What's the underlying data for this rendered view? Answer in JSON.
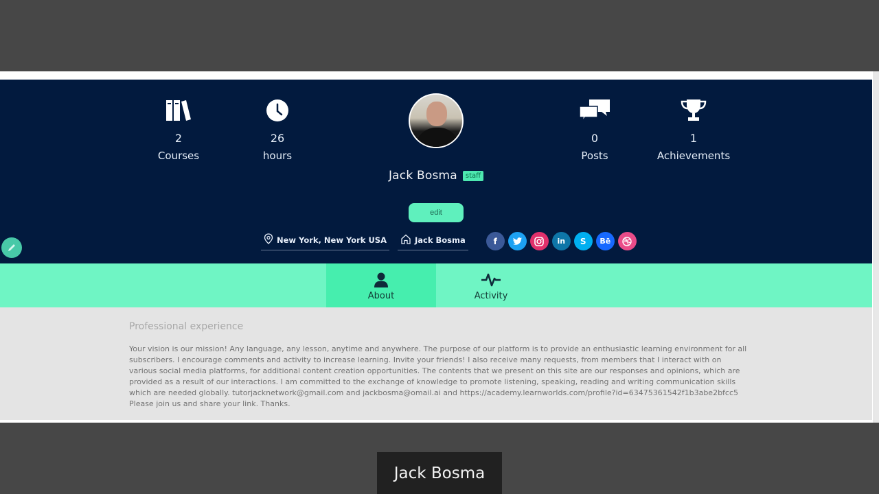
{
  "profile": {
    "name": "Jack Bosma",
    "badge": "staff",
    "edit_label": "edit",
    "location": "New York, New York USA",
    "website_label": "Jack Bosma"
  },
  "stats": [
    {
      "icon": "books-icon",
      "value": "2",
      "label": "Courses"
    },
    {
      "icon": "clock-icon",
      "value": "26",
      "label": "hours"
    },
    {
      "icon": "chat-bubbles-icon",
      "value": "0",
      "label": "Posts"
    },
    {
      "icon": "trophy-icon",
      "value": "1",
      "label": "Achievements"
    }
  ],
  "socials": [
    {
      "name": "facebook",
      "glyph": "f",
      "color": "#3b5998"
    },
    {
      "name": "twitter",
      "glyph": "t",
      "color": "#1da1f2"
    },
    {
      "name": "instagram",
      "glyph": "ig",
      "color": "#e1306c"
    },
    {
      "name": "linkedin",
      "glyph": "in",
      "color": "#0e76a8"
    },
    {
      "name": "skype",
      "glyph": "S",
      "color": "#00aff0"
    },
    {
      "name": "behance",
      "glyph": "Bē",
      "color": "#1769ff"
    },
    {
      "name": "dribbble",
      "glyph": "◎",
      "color": "#ea4c89"
    }
  ],
  "tabs": [
    {
      "label": "About",
      "icon": "user-icon",
      "active": true
    },
    {
      "label": "Activity",
      "icon": "activity-pulse-icon",
      "active": false
    }
  ],
  "about": {
    "section_title": "Professional experience",
    "bio": "Your vision is our mission! Any language, any lesson, anytime and anywhere. The purpose of our platform is to provide an enthusiastic learning environment for all subscribers. I encourage comments and activity to increase learning. Invite your friends! I also receive many requests, from members that I interact with on various social media platforms, for additional content creation opportunities. The contents that we present on this site are our responses and opinions, which are provided as a result of our interactions. I am committed to the exchange of knowledge to promote listening, speaking, reading and writing communication skills which are needed globally. tutorjacknetwork@gmail.com and jackbosma@omail.ai and https://academy.learnworlds.com/profile?id=63475361542f1b3abe2bfcc5 Please join us and share your link. Thanks."
  },
  "caption": "Jack Bosma",
  "colors": {
    "header_bg": "#021a3e",
    "accent": "#6ff5c4",
    "accent_active": "#46eeae"
  }
}
